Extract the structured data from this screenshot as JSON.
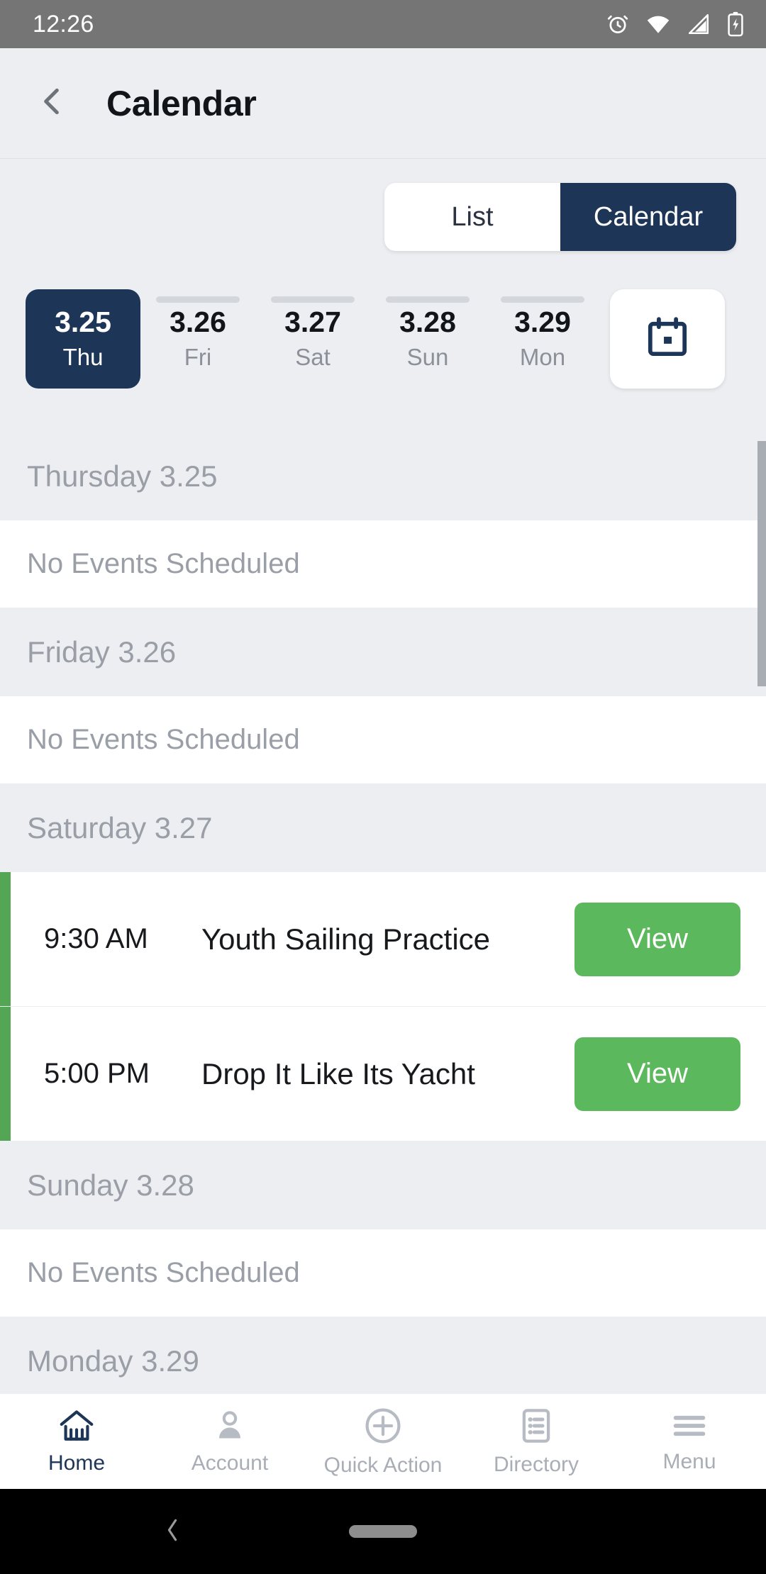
{
  "status_bar": {
    "time": "12:26",
    "icons": [
      "alarm-icon",
      "wifi-icon",
      "signal-icon",
      "battery-charging-icon"
    ]
  },
  "header": {
    "back_icon": "chevron-left-icon",
    "title": "Calendar"
  },
  "view_toggle": {
    "options": [
      "List",
      "Calendar"
    ],
    "selected": "Calendar",
    "list_label": "List",
    "calendar_label": "Calendar"
  },
  "date_strip": {
    "days": [
      {
        "date": "3.25",
        "weekday": "Thu",
        "selected": true
      },
      {
        "date": "3.26",
        "weekday": "Fri",
        "selected": false
      },
      {
        "date": "3.27",
        "weekday": "Sat",
        "selected": false
      },
      {
        "date": "3.28",
        "weekday": "Sun",
        "selected": false
      },
      {
        "date": "3.29",
        "weekday": "Mon",
        "selected": false
      }
    ],
    "picker_icon": "calendar-icon"
  },
  "agenda": {
    "empty_text": "No Events Scheduled",
    "sections": [
      {
        "header": "Thursday 3.25",
        "events": []
      },
      {
        "header": "Friday 3.26",
        "events": []
      },
      {
        "header": "Saturday 3.27",
        "events": [
          {
            "time": "9:30 AM",
            "title": "Youth Sailing Practice",
            "action": "View"
          },
          {
            "time": "5:00 PM",
            "title": "Drop It Like Its Yacht",
            "action": "View"
          }
        ]
      },
      {
        "header": "Sunday 3.28",
        "events": []
      },
      {
        "header": "Monday 3.29",
        "events": []
      }
    ]
  },
  "bottom_nav": {
    "items": [
      {
        "label": "Home",
        "icon": "home-icon",
        "active": true
      },
      {
        "label": "Account",
        "icon": "person-icon",
        "active": false
      },
      {
        "label": "Quick Action",
        "icon": "plus-circle-icon",
        "active": false
      },
      {
        "label": "Directory",
        "icon": "list-document-icon",
        "active": false
      },
      {
        "label": "Menu",
        "icon": "hamburger-menu-icon",
        "active": false
      }
    ]
  },
  "android_nav": {
    "back_icon": "chevron-left-icon",
    "home_pill": "gesture-pill"
  },
  "colors": {
    "brand_navy": "#1d3557",
    "accent_green": "#52a654",
    "button_green": "#5cb85c",
    "page_bg": "#eceef2",
    "muted_text": "#9a9ea6"
  }
}
